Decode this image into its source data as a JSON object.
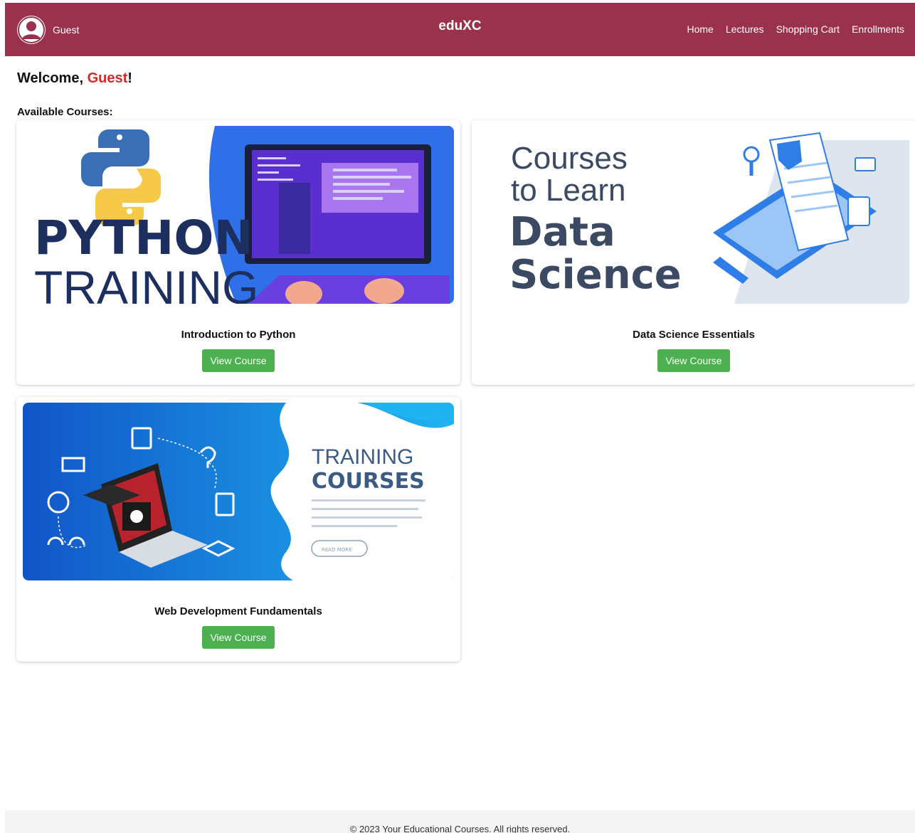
{
  "header": {
    "user_name": "Guest",
    "brand": "eduXC",
    "nav": [
      "Home",
      "Lectures",
      "Shopping Cart",
      "Enrollments"
    ]
  },
  "welcome": {
    "prefix": "Welcome, ",
    "name": "Guest",
    "suffix": "!"
  },
  "section_title": "Available Courses:",
  "courses": [
    {
      "title": "Introduction to Python",
      "button": "View Course",
      "image_text": [
        "PYTHON",
        "TRAINING"
      ]
    },
    {
      "title": "Data Science Essentials",
      "button": "View Course",
      "image_text": [
        "Courses",
        "to Learn",
        "Data",
        "Science"
      ]
    },
    {
      "title": "Web Development Fundamentals",
      "button": "View Course",
      "image_text": [
        "TRAINING",
        "COURSES",
        "READ MORE"
      ]
    }
  ],
  "footer": "© 2023 Your Educational Courses. All rights reserved.",
  "colors": {
    "header_bg": "#9a314d",
    "button_bg": "#4caf50",
    "welcome_name": "#d42a2a"
  }
}
